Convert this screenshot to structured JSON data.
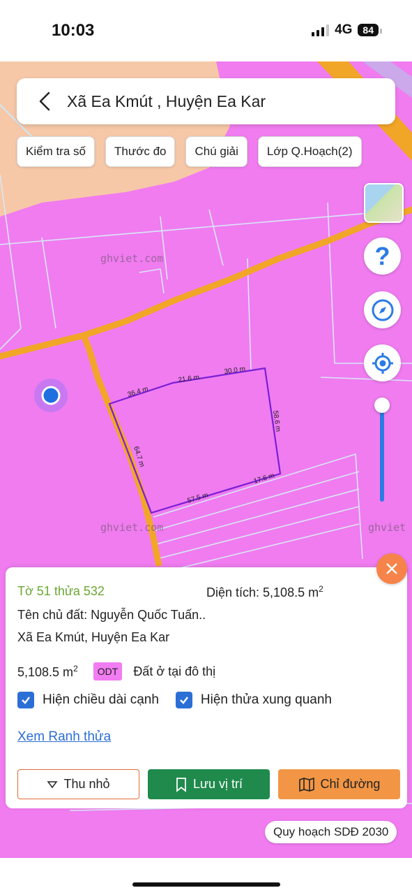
{
  "status": {
    "time": "10:03",
    "network": "4G",
    "battery": "84"
  },
  "header": {
    "title": "Xã Ea Kmút , Huyện Ea Kar"
  },
  "chips": [
    {
      "label": "Kiểm tra số"
    },
    {
      "label": "Thước đo"
    },
    {
      "label": "Chú giải"
    },
    {
      "label": "Lớp Q.Hoạch(2)"
    }
  ],
  "map": {
    "watermark": "ghviet.com",
    "watermark_partial": "ghviet",
    "edges": [
      "36.4 m",
      "21.6 m",
      "30.0 m",
      "58.6 m",
      "17.6 m",
      "57.5 m",
      "64.7 m"
    ],
    "colors": {
      "land": "#f07cf0",
      "road": "#f2a628",
      "parcel": "#7a1fd6",
      "location": "#1f6fe0"
    }
  },
  "panel": {
    "parcel": "Tờ 51 thửa 532",
    "area_label": "Diện tích: 5,108.5 m",
    "area_sup": "2",
    "owner": "Tên chủ đất: Nguyễn Quốc Tuấn..",
    "address": "Xã Ea Kmút, Huyện Ea Kar",
    "area_value": "5,108.5 m",
    "area_value_sup": "2",
    "land_code": "ODT",
    "land_type": "Đất ở tại đô thị",
    "show_edges": "Hiện chiều dài cạnh",
    "show_neighbors": "Hiện thửa xung quanh",
    "view_boundary": "Xem Ranh thửa",
    "btn_minimize": "Thu nhỏ",
    "btn_save": "Lưu vị trí",
    "btn_directions": "Chỉ đường"
  },
  "plan_label": "Quy hoạch SDĐ 2030"
}
